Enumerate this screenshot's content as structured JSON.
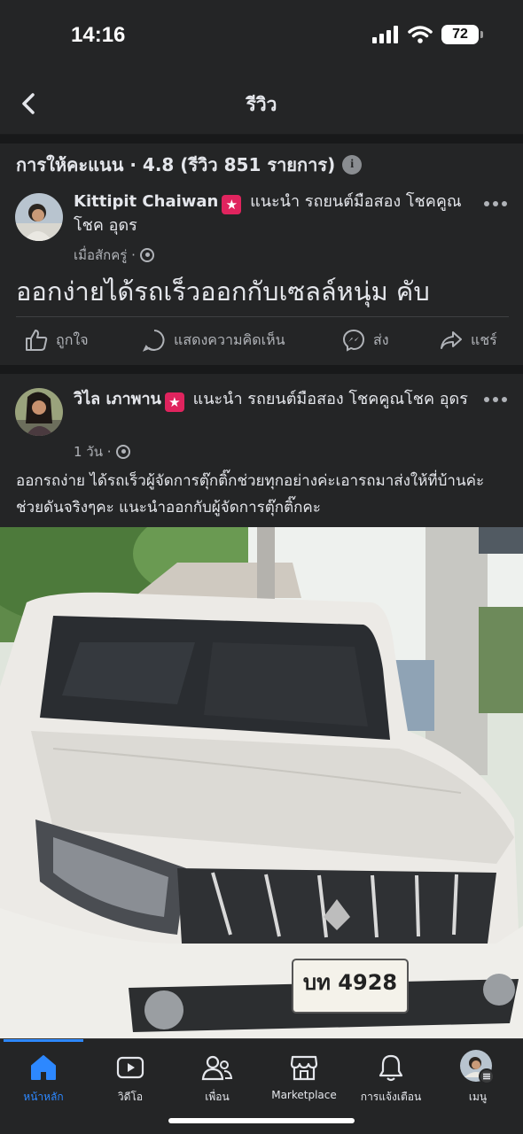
{
  "status": {
    "time": "14:16",
    "battery": "72"
  },
  "header": {
    "title": "รีวิว"
  },
  "rating": {
    "summary": "การให้คะแนน · 4.8 (รีวิว 851 รายการ)"
  },
  "posts": [
    {
      "author": "Kittipit Chaiwan",
      "recommends": "แนะนำ รถยนต์มือสอง โชคคูณโชค อุดร",
      "time": "เมื่อสักครู่ ·",
      "text": "ออกง่ายได้รถเร็วออกกับเซลล์หนุ่ม คับ"
    },
    {
      "author": "วิไล เภาพาน",
      "recommends": "แนะนำ รถยนต์มือสอง โชคคูณโชค อุดร",
      "time": "1 วัน ·",
      "text": "ออกรถง่าย ได้รถเร็วผู้จัดการตุ๊กติ๊กช่วยทุกอย่างค่ะเอารถมาส่งให้ที่บ้านค่ะ ช่วยดันจริงๆคะ แนะนำออกกับผู้จัดการตุ๊กติ๊กคะ",
      "plate": "บท 4928"
    }
  ],
  "actions": {
    "like": "ถูกใจ",
    "comment": "แสดงความคิดเห็น",
    "send": "ส่ง",
    "share": "แชร์"
  },
  "tabs": [
    {
      "label": "หน้าหลัก",
      "icon": "home-icon",
      "active": true
    },
    {
      "label": "วิดีโอ",
      "icon": "video-icon"
    },
    {
      "label": "เพื่อน",
      "icon": "friends-icon"
    },
    {
      "label": "Marketplace",
      "icon": "marketplace-icon"
    },
    {
      "label": "การแจ้งเตือน",
      "icon": "bell-icon"
    },
    {
      "label": "เมนู",
      "icon": "profile-avatar"
    }
  ],
  "colors": {
    "background": "#242526",
    "separator": "#18191a",
    "accent": "#2d88ff",
    "text": "#e4e6eb",
    "secondary_text": "#b0b3b8"
  }
}
